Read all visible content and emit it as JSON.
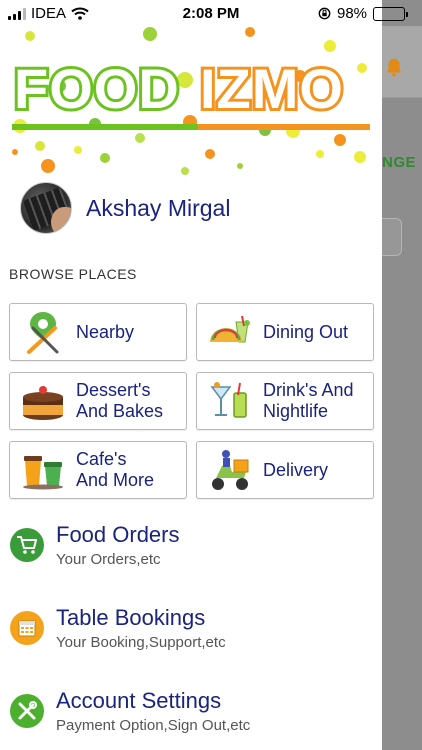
{
  "status_bar": {
    "carrier": "IDEA",
    "time": "2:08 PM",
    "battery": "98%"
  },
  "brand": {
    "logo_part1": "FOOD",
    "logo_part2": "IZMO",
    "color_green": "#6cc21e",
    "color_orange": "#f5931e"
  },
  "profile": {
    "name": "Akshay Mirgal"
  },
  "browse": {
    "title": "BROWSE PLACES",
    "tiles": [
      {
        "line1": "Nearby",
        "line2": "",
        "icon": "location-cutlery-icon"
      },
      {
        "line1": "Dining Out",
        "line2": "",
        "icon": "taco-drink-icon"
      },
      {
        "line1": "Dessert's",
        "line2": "And Bakes",
        "icon": "cake-icon"
      },
      {
        "line1": "Drink's And",
        "line2": "Nightlife",
        "icon": "cocktail-icon"
      },
      {
        "line1": "Cafe's",
        "line2": "And More",
        "icon": "coffee-cup-icon"
      },
      {
        "line1": "Delivery",
        "line2": "",
        "icon": "delivery-scooter-icon"
      }
    ]
  },
  "menu": [
    {
      "title": "Food Orders",
      "subtitle": "Your Orders,etc",
      "icon": "cart-icon",
      "color": "#3a9b3a"
    },
    {
      "title": "Table Bookings",
      "subtitle": "Your Booking,Support,etc",
      "icon": "calendar-icon",
      "color": "#f5a21b"
    },
    {
      "title": "Account Settings",
      "subtitle": "Payment Option,Sign Out,etc",
      "icon": "tools-icon",
      "color": "#4caf2e"
    }
  ],
  "background": {
    "partial_text": "NGE"
  }
}
